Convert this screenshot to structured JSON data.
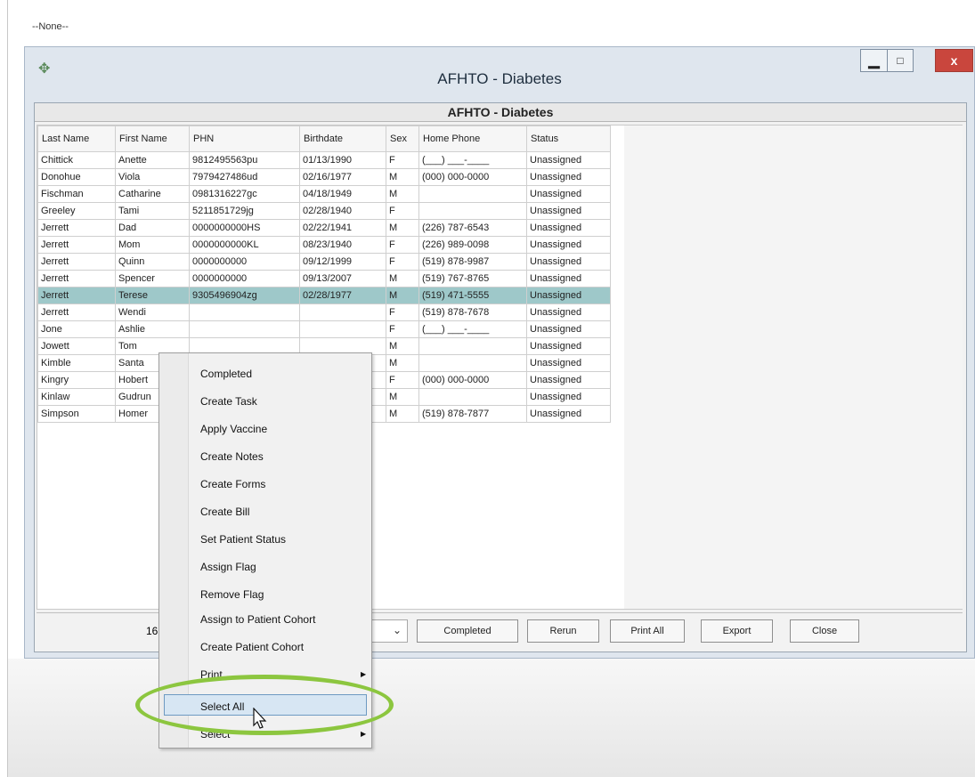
{
  "top_label": "--None--",
  "window": {
    "title": "AFHTO - Diabetes",
    "minimize": "▁",
    "maximize": "□",
    "close": "x",
    "icon": "compass-icon"
  },
  "report_title": "AFHTO - Diabetes",
  "columns": [
    "Last Name",
    "First Name",
    "PHN",
    "Birthdate",
    "Sex",
    "Home Phone",
    "Status"
  ],
  "rows": [
    [
      "Chittick",
      "Anette",
      "9812495563pu",
      "01/13/1990",
      "F",
      "(___) ___-____",
      "Unassigned"
    ],
    [
      "Donohue",
      "Viola",
      "7979427486ud",
      "02/16/1977",
      "M",
      "(000) 000-0000",
      "Unassigned"
    ],
    [
      "Fischman",
      "Catharine",
      "0981316227gc",
      "04/18/1949",
      "M",
      "",
      "Unassigned"
    ],
    [
      "Greeley",
      "Tami",
      "5211851729jg",
      "02/28/1940",
      "F",
      "",
      "Unassigned"
    ],
    [
      "Jerrett",
      "Dad",
      "0000000000HS",
      "02/22/1941",
      "M",
      "(226) 787-6543",
      "Unassigned"
    ],
    [
      "Jerrett",
      "Mom",
      "0000000000KL",
      "08/23/1940",
      "F",
      "(226) 989-0098",
      "Unassigned"
    ],
    [
      "Jerrett",
      "Quinn",
      "0000000000",
      "09/12/1999",
      "F",
      "(519) 878-9987",
      "Unassigned"
    ],
    [
      "Jerrett",
      "Spencer",
      "0000000000",
      "09/13/2007",
      "M",
      "(519) 767-8765",
      "Unassigned"
    ],
    [
      "Jerrett",
      "Terese",
      "9305496904zg",
      "02/28/1977",
      "M",
      "(519) 471-5555",
      "Unassigned"
    ],
    [
      "Jerrett",
      "Wendi",
      "",
      "",
      "F",
      "(519) 878-7678",
      "Unassigned"
    ],
    [
      "Jone",
      "Ashlie",
      "",
      "",
      "F",
      "(___) ___-____",
      "Unassigned"
    ],
    [
      "Jowett",
      "Tom",
      "",
      "",
      "M",
      "",
      "Unassigned"
    ],
    [
      "Kimble",
      "Santa",
      "",
      "",
      "M",
      "",
      "Unassigned"
    ],
    [
      "Kingry",
      "Hobert",
      "",
      "",
      "F",
      "(000) 000-0000",
      "Unassigned"
    ],
    [
      "Kinlaw",
      "Gudrun",
      "",
      "",
      "M",
      "",
      "Unassigned"
    ],
    [
      "Simpson",
      "Homer",
      "",
      "",
      "M",
      "(519) 878-7877",
      "Unassigned"
    ]
  ],
  "selected_row_index": 8,
  "footer": {
    "count": "16",
    "buttons": [
      "Completed",
      "Rerun",
      "Print All",
      "Export",
      "Close"
    ]
  },
  "context_menu": {
    "items": [
      "Completed",
      "Create Task",
      "Apply Vaccine",
      "Create Notes",
      "Create Forms",
      "Create Bill",
      "Set Patient Status",
      "Assign Flag",
      "Remove Flag",
      "Assign to Patient Cohort",
      "Create Patient Cohort",
      "Print",
      "Select All",
      "Select"
    ],
    "hovered": "Select All"
  },
  "highlight_color": "#8cc63f"
}
